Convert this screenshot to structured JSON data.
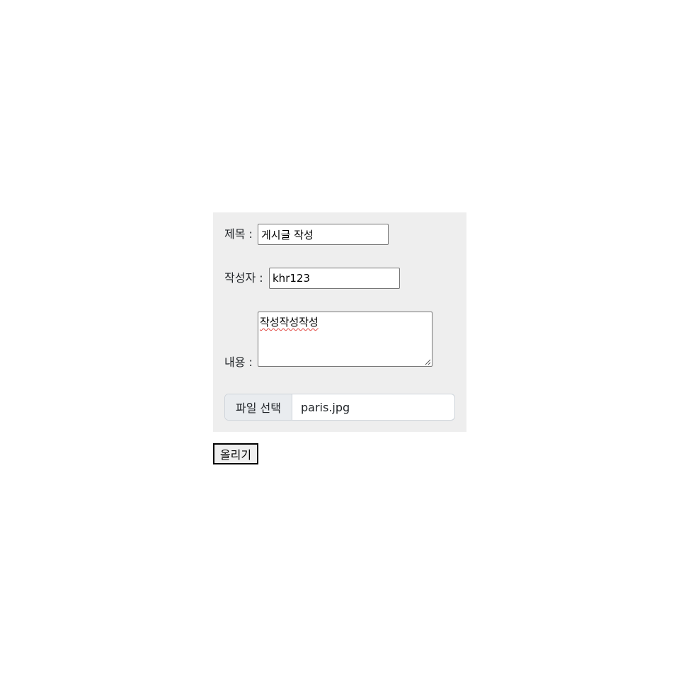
{
  "form": {
    "title_label": "제목 :",
    "title_value": "게시글 작성",
    "writer_label": "작성자 :",
    "writer_value": "khr123",
    "content_label": "내용 :",
    "content_value": "작성작성작성",
    "file_button_label": "파일 선택",
    "file_name": "paris.jpg",
    "submit_label": "올리기"
  },
  "colors": {
    "panel_background": "#eeeeee",
    "spellcheck_underline": "#e0443e"
  }
}
